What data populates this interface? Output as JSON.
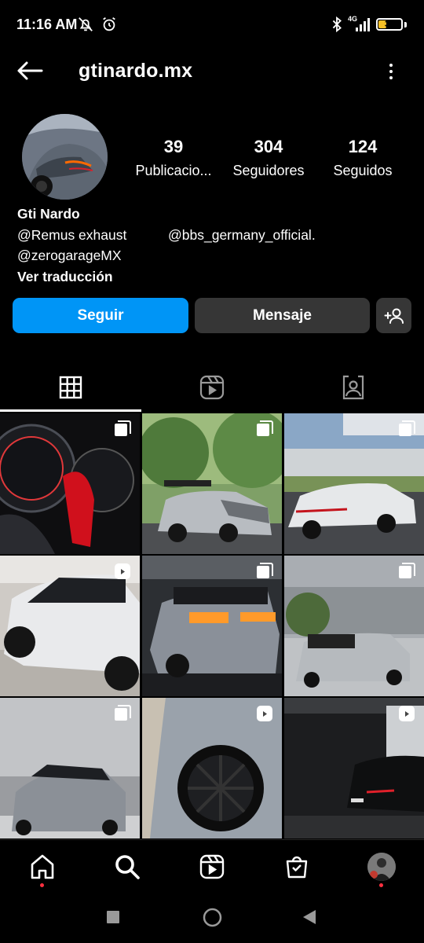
{
  "status_bar": {
    "time": "11:16 AM",
    "network": "4G",
    "battery": "36",
    "battery_level": 0.36,
    "battery_color": "#f6c026",
    "icons_left": [
      "mute-icon",
      "alarm-icon"
    ],
    "icons_right": [
      "bluetooth-icon",
      "signal-icon",
      "battery-icon"
    ]
  },
  "header": {
    "username": "gtinardo.mx"
  },
  "profile": {
    "stats": [
      {
        "value": "39",
        "label": "Publicacio..."
      },
      {
        "value": "304",
        "label": "Seguidores"
      },
      {
        "value": "124",
        "label": "Seguidos"
      }
    ],
    "bio": {
      "name": "Gti Nardo",
      "mention_1": "@Remus exhaust",
      "mention_2": "@bbs_germany_official.",
      "mention_3": "@zerogarageMX",
      "translate": "Ver traducción"
    }
  },
  "actions": {
    "follow": "Seguir",
    "message": "Mensaje",
    "follow_color": "#0095f6"
  },
  "tabs": [
    "grid-icon",
    "reels-icon",
    "tagged-icon"
  ],
  "grid": {
    "posts": [
      {
        "badge": "carousel-icon"
      },
      {
        "badge": "carousel-icon"
      },
      {
        "badge": "carousel-icon"
      },
      {
        "badge": "reel-icon"
      },
      {
        "badge": "carousel-icon"
      },
      {
        "badge": "carousel-icon"
      },
      {
        "badge": "carousel-icon"
      },
      {
        "badge": "reel-icon"
      },
      {
        "badge": "reel-icon"
      }
    ]
  },
  "bottom_nav": [
    "home-icon",
    "search-icon",
    "reels-icon",
    "shop-icon",
    "profile-avatar"
  ],
  "system_nav": [
    "recents-icon",
    "home-circle-icon",
    "back-triangle-icon"
  ]
}
